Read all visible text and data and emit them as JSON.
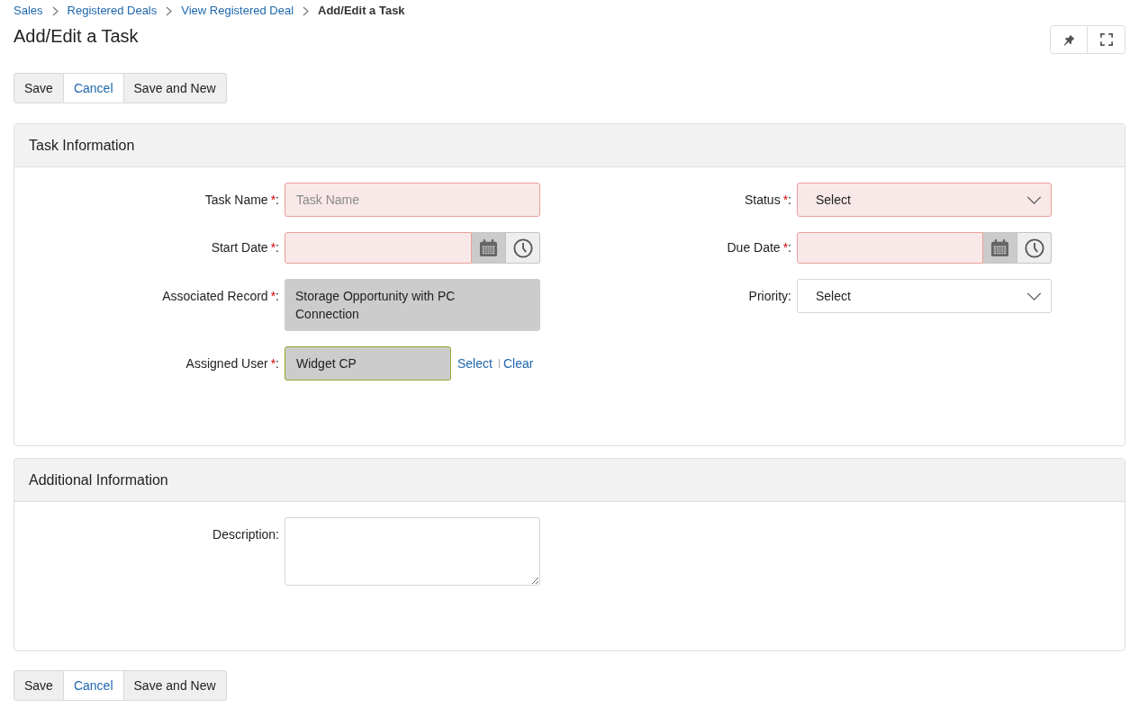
{
  "breadcrumbs": [
    {
      "label": "Sales",
      "kind": "link"
    },
    {
      "label": "Registered Deals",
      "kind": "link"
    },
    {
      "label": "View Registered Deal",
      "kind": "link"
    },
    {
      "label": "Add/Edit a Task",
      "kind": "current"
    }
  ],
  "page_title": "Add/Edit a Task",
  "top_actions": [
    {
      "label": "Save",
      "kind": "default"
    },
    {
      "label": "Cancel",
      "kind": "link"
    },
    {
      "label": "Save and New",
      "kind": "default"
    }
  ],
  "sections": [
    {
      "title": "Task Information",
      "rows": [
        [
          {
            "kind": "text",
            "label": "Task Name",
            "required_mark": "*",
            "colon": ":",
            "placeholder": "Task Name",
            "invalid": true
          },
          {
            "kind": "select",
            "label": "Status",
            "required_mark": "*",
            "colon": ":",
            "value": "Select",
            "invalid": true
          }
        ],
        [
          {
            "kind": "datetime",
            "label": "Start Date",
            "required_mark": "*",
            "colon": ":",
            "invalid": true
          },
          {
            "kind": "datetime",
            "label": "Due Date",
            "required_mark": "*",
            "colon": ":",
            "invalid": true
          }
        ],
        [
          {
            "kind": "readonly",
            "label": "Associated Record",
            "required_mark": "*",
            "colon": ":",
            "value": "Storage Opportunity with PC Connection",
            "invalid": false
          },
          {
            "kind": "select",
            "label": "Priority",
            "colon": ":",
            "value": "Select",
            "invalid": false
          }
        ],
        [
          {
            "kind": "lookup",
            "label": "Assigned User",
            "required_mark": "*",
            "colon": ":",
            "value": "Widget CP",
            "invalid": false,
            "valid": true,
            "actions": [
              "Select",
              "Clear"
            ]
          }
        ]
      ]
    },
    {
      "title": "Additional Information",
      "rows": [
        [
          {
            "kind": "textarea",
            "label": "Description",
            "colon": ":",
            "invalid": false
          }
        ]
      ]
    }
  ],
  "bottom_actions": [
    {
      "label": "Save",
      "kind": "default"
    },
    {
      "label": "Cancel",
      "kind": "link"
    },
    {
      "label": "Save and New",
      "kind": "default"
    }
  ]
}
